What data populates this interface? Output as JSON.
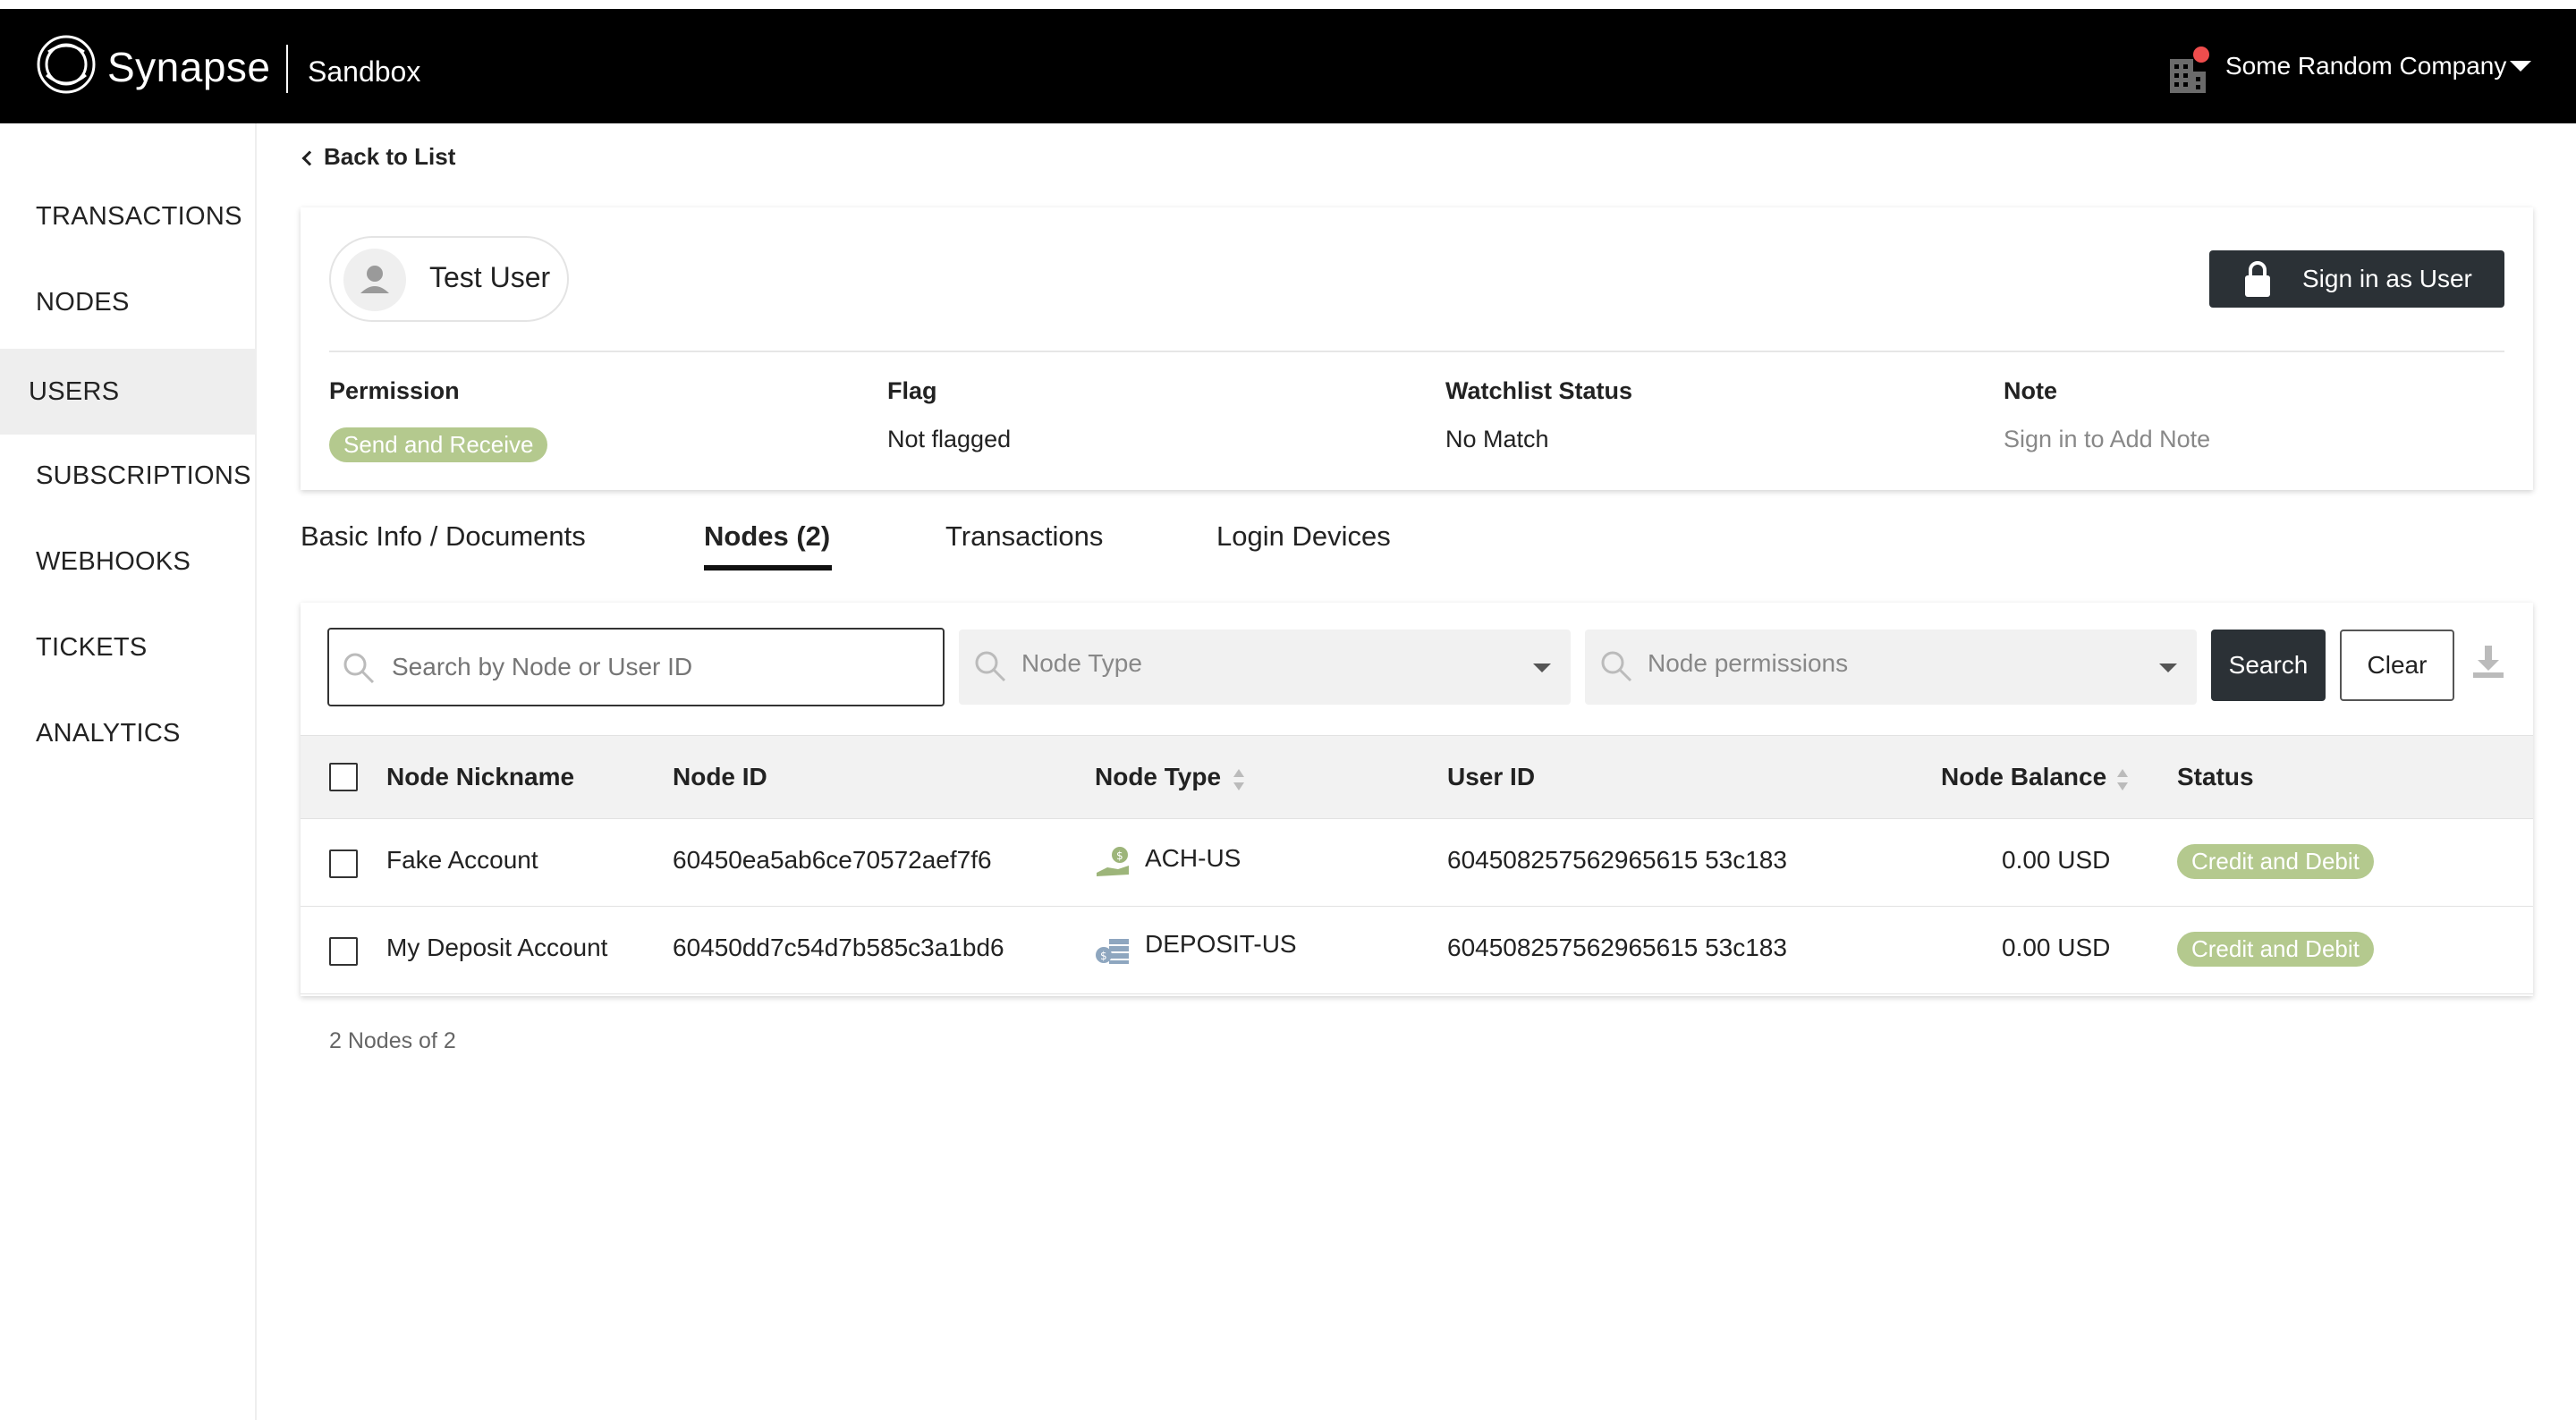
{
  "header": {
    "brand": "Synapse",
    "environment": "Sandbox",
    "company": "Some Random Company",
    "notification_color": "#ef4d4d"
  },
  "sidebar": {
    "items": [
      {
        "label": "TRANSACTIONS",
        "active": false
      },
      {
        "label": "NODES",
        "active": false
      },
      {
        "label": "USERS",
        "active": true
      },
      {
        "label": "SUBSCRIPTIONS",
        "active": false
      },
      {
        "label": "WEBHOOKS",
        "active": false
      },
      {
        "label": "TICKETS",
        "active": false
      },
      {
        "label": "ANALYTICS",
        "active": false
      }
    ]
  },
  "back_link": "Back to List",
  "user": {
    "name": "Test User",
    "sign_in_label": "Sign in as User",
    "fields": {
      "permission_label": "Permission",
      "permission_value": "Send and Receive",
      "flag_label": "Flag",
      "flag_value": "Not flagged",
      "watchlist_label": "Watchlist Status",
      "watchlist_value": "No Match",
      "note_label": "Note",
      "note_value": "Sign in to Add Note"
    }
  },
  "tabs": [
    {
      "label": "Basic Info / Documents",
      "active": false
    },
    {
      "label": "Nodes (2)",
      "active": true
    },
    {
      "label": "Transactions",
      "active": false
    },
    {
      "label": "Login Devices",
      "active": false
    }
  ],
  "filters": {
    "search_placeholder": "Search by Node or User ID",
    "node_type_placeholder": "Node Type",
    "node_permissions_placeholder": "Node permissions",
    "search_button": "Search",
    "clear_button": "Clear"
  },
  "table": {
    "columns": [
      "Node Nickname",
      "Node ID",
      "Node Type",
      "User ID",
      "Node Balance",
      "Status"
    ],
    "rows": [
      {
        "nickname": "Fake Account",
        "node_id": "60450ea5ab6ce70572aef7f6",
        "node_type": "ACH-US",
        "type_icon": "bank-hand-icon",
        "user_id": "604508257562965615 53c183",
        "balance": "0.00 USD",
        "status": "Credit and Debit"
      },
      {
        "nickname": "My Deposit Account",
        "node_id": "60450dd7c54d7b585c3a1bd6",
        "node_type": "DEPOSIT-US",
        "type_icon": "deposit-cash-icon",
        "user_id": "604508257562965615 53c183",
        "balance": "0.00 USD",
        "status": "Credit and Debit"
      }
    ]
  },
  "footer_count": "2 Nodes of 2",
  "colors": {
    "badge_green": "#b4c98e",
    "dark_button": "#2b3136"
  }
}
